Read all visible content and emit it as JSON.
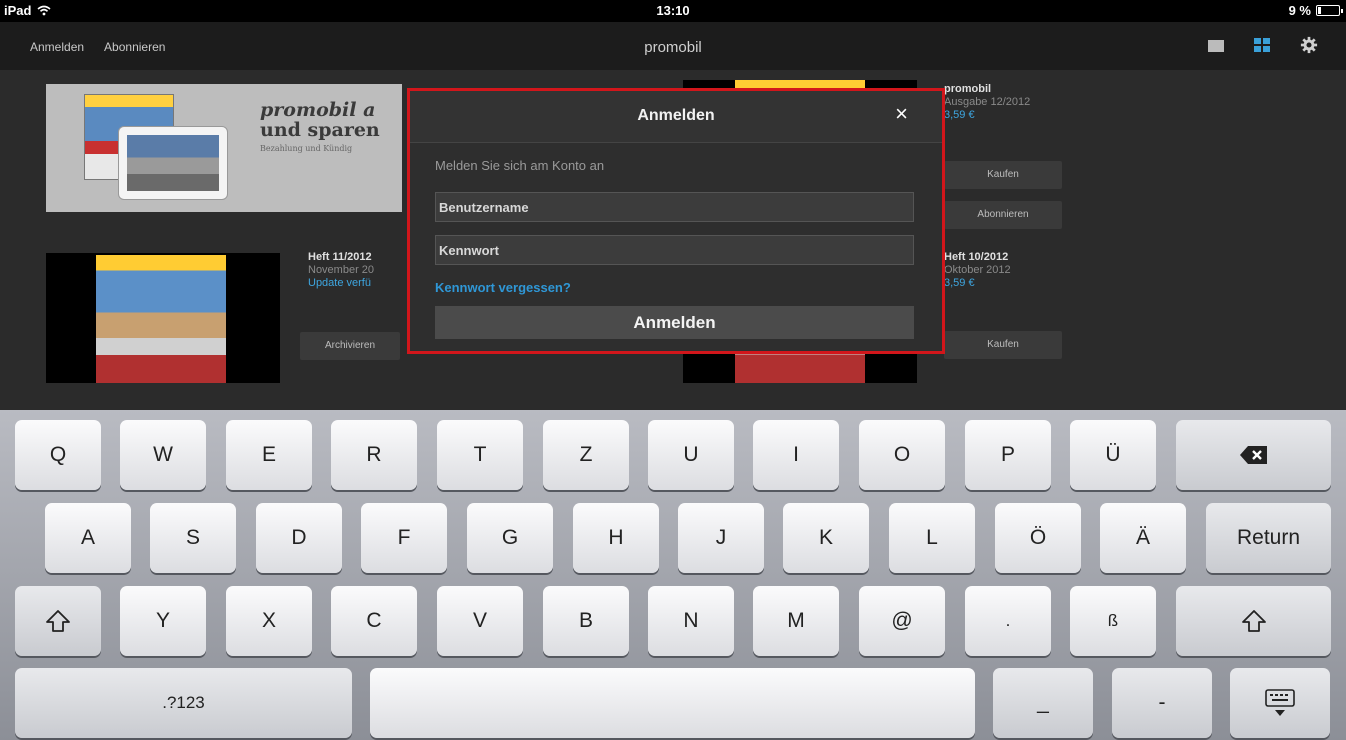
{
  "status_bar": {
    "device": "iPad",
    "time": "13:10",
    "battery": "9 %"
  },
  "nav_bar": {
    "left_items": [
      "Anmelden",
      "Abonnieren"
    ],
    "title": "promobil"
  },
  "store": {
    "banner": {
      "title_line1": "promobil a",
      "title_line2": "und sparen",
      "subtitle": "Bezahlung und Kündig"
    },
    "issues": [
      {
        "title": "Heft 11/2012",
        "date": "November 20",
        "status": "Update verfü",
        "button": "Archivieren"
      },
      {
        "title": "promobil",
        "date": "Ausgabe 12/2012",
        "price": "3,59 €",
        "buttons": [
          "Kaufen",
          "Abonnieren"
        ]
      },
      {
        "title": "Heft 10/2012",
        "date": "Oktober 2012",
        "price": "3,59 €",
        "button": "Kaufen"
      }
    ]
  },
  "dialog": {
    "title": "Anmelden",
    "close": "×",
    "subtitle": "Melden Sie sich am Konto an",
    "username_placeholder": "Benutzername",
    "password_placeholder": "Kennwort",
    "forgot_link": "Kennwort vergessen?",
    "submit_label": "Anmelden",
    "highlight_color": "#d2161b"
  },
  "keyboard": {
    "row1": [
      "Q",
      "W",
      "E",
      "R",
      "T",
      "Z",
      "U",
      "I",
      "O",
      "P",
      "Ü"
    ],
    "row2": [
      "A",
      "S",
      "D",
      "F",
      "G",
      "H",
      "J",
      "K",
      "L",
      "Ö",
      "Ä"
    ],
    "row2_return": "Return",
    "row3": [
      "Y",
      "X",
      "C",
      "V",
      "B",
      "N",
      "M",
      "@",
      ".",
      "ß"
    ],
    "row4_numbers": ".?123",
    "row4_underscore": "_",
    "row4_dash": "-"
  }
}
